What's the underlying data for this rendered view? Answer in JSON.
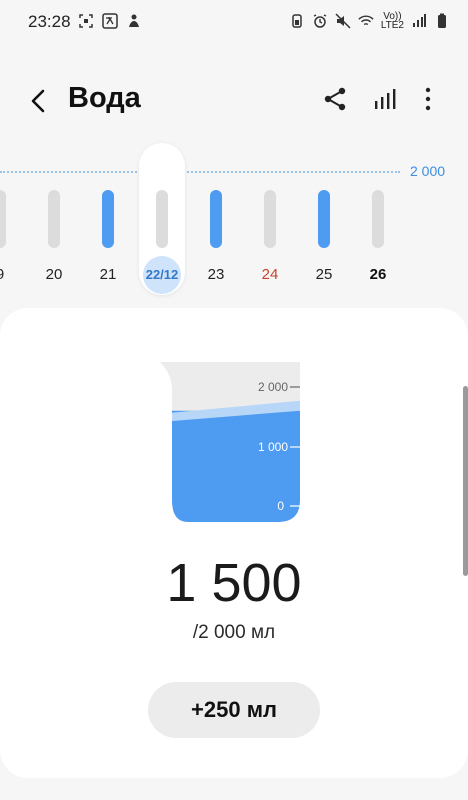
{
  "status": {
    "time": "23:28",
    "network_top": "Vo))",
    "network_bottom": "LTE2"
  },
  "header": {
    "title": "Вода"
  },
  "week": {
    "goal_label": "2 000",
    "goal": 2000,
    "days": [
      {
        "label": "9",
        "value": 0,
        "variant": "normal"
      },
      {
        "label": "20",
        "value": 0,
        "variant": "normal"
      },
      {
        "label": "21",
        "value": 2000,
        "variant": "normal"
      },
      {
        "label": "22/12",
        "value": 0,
        "variant": "selected"
      },
      {
        "label": "23",
        "value": 2000,
        "variant": "normal"
      },
      {
        "label": "24",
        "value": 0,
        "variant": "sunday"
      },
      {
        "label": "25",
        "value": 2000,
        "variant": "normal"
      },
      {
        "label": "26",
        "value": 0,
        "variant": "future"
      }
    ]
  },
  "beaker": {
    "scale_labels": [
      "2 000",
      "1 000",
      "0"
    ],
    "fill_fraction": 0.75
  },
  "summary": {
    "amount": "1 500",
    "goal_text": "/2 000 мл"
  },
  "actions": {
    "add_label": "+250 мл"
  },
  "colors": {
    "accent": "#4e9bf2",
    "sunday": "#c8432e"
  }
}
